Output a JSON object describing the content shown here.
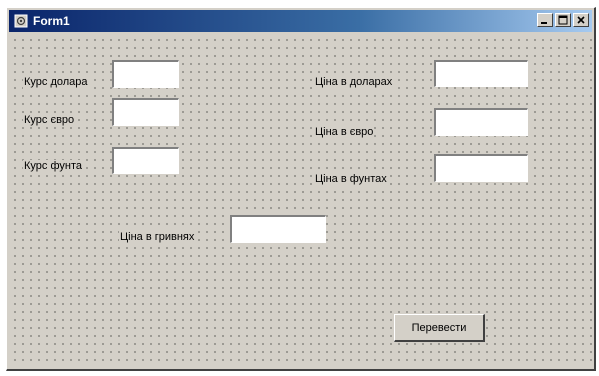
{
  "window": {
    "title": "Form1",
    "title_bar_color": "#0a246a",
    "face_color": "#d4d0c8",
    "controls": {
      "minimize": "minimize-icon",
      "maximize": "maximize-icon",
      "close": "close-icon"
    }
  },
  "form": {
    "labels": {
      "usd_rate": "Курс долара",
      "eur_rate": "Курс євро",
      "gbp_rate": "Курс фунта",
      "price_usd": "Ціна в доларах",
      "price_eur": "Ціна в євро",
      "price_gbp": "Ціна в фунтах",
      "price_uah": "Ціна в гривнях"
    },
    "values": {
      "usd_rate": "",
      "eur_rate": "",
      "gbp_rate": "",
      "price_usd": "",
      "price_eur": "",
      "price_gbp": "",
      "price_uah": ""
    },
    "convert_button": "Перевести"
  }
}
